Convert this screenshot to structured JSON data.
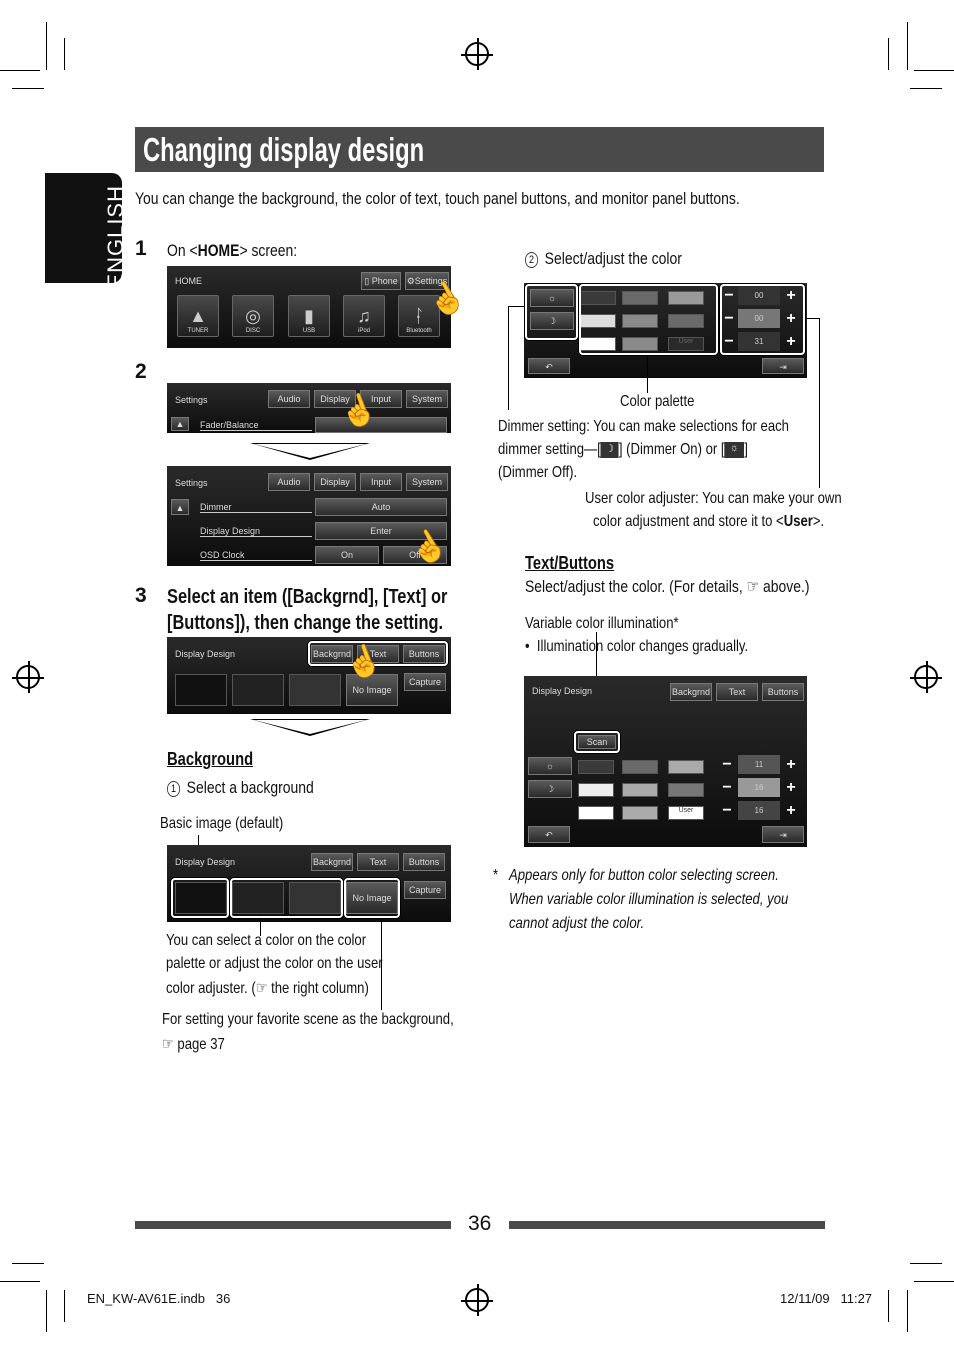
{
  "title": "Changing display design",
  "language_tab": "ENGLISH",
  "intro": "You can change the background, the color of text, touch panel buttons, and monitor panel buttons.",
  "step1": {
    "num": "1",
    "text_pre": "On <",
    "text_bold": "HOME",
    "text_post": "> screen:",
    "screen": {
      "title": "HOME",
      "phone": "Phone",
      "settings": "Settings",
      "icons": [
        "TUNER",
        "DISC",
        "USB",
        "iPod",
        "Bluetooth"
      ]
    }
  },
  "step2": {
    "num": "2",
    "screen_a": {
      "title": "Settings",
      "tabs": [
        "Audio",
        "Display",
        "Input",
        "System"
      ],
      "row": "Fader/Balance"
    },
    "screen_b": {
      "title": "Settings",
      "tabs": [
        "Audio",
        "Display",
        "Input",
        "System"
      ],
      "rows": [
        {
          "label": "Dimmer",
          "value": "Auto"
        },
        {
          "label": "Display Design",
          "value": "Enter"
        },
        {
          "label": "OSD Clock",
          "value": "On",
          "value2": "Off"
        }
      ]
    }
  },
  "step3": {
    "num": "3",
    "line1": "Select an item ([Backgrnd], [Text] or",
    "line2": "[Buttons]), then change the setting.",
    "screen": {
      "title": "Display Design",
      "tabs": [
        "Backgrnd",
        "Text",
        "Buttons"
      ],
      "no_image": "No Image",
      "capture": "Capture"
    }
  },
  "background": {
    "heading": "Background",
    "sub_num": "1",
    "sub_text": "Select a background",
    "basic_label": "Basic image (default)",
    "screen": {
      "title": "Display Design",
      "tabs": [
        "Backgrnd",
        "Text",
        "Buttons"
      ],
      "no_image": "No Image",
      "capture": "Capture"
    },
    "note1": [
      "You can select a color on the color",
      "palette or adjust the color on the user",
      "color adjuster. (☞ the right column)"
    ],
    "note2": [
      "For setting your favorite scene as the background,",
      "☞ page 37"
    ]
  },
  "right": {
    "sub_num": "2",
    "sub_text": "Select/adjust the color",
    "palette_screen": {
      "values": [
        "00",
        "00",
        "31"
      ],
      "user": "User"
    },
    "color_palette_label": "Color palette",
    "dimmer_note": [
      "Dimmer setting: You can make selections for each",
      "dimmer setting—[",
      "] (Dimmer On) or [",
      "]",
      "(Dimmer Off)."
    ],
    "user_note": [
      "User color adjuster: You can make your own",
      "color adjustment and store it to <",
      "User",
      ">."
    ],
    "text_buttons_heading": "Text/Buttons",
    "text_buttons_text": "Select/adjust the color. (For details, ☞ above.)",
    "variable_label": "Variable color illumination*",
    "variable_bullet": "Illumination color changes gradually.",
    "scan_screen": {
      "title": "Display Design",
      "tabs": [
        "Backgrnd",
        "Text",
        "Buttons"
      ],
      "scan": "Scan",
      "values": [
        "11",
        "16",
        "16"
      ],
      "user": "User"
    },
    "footnote_mark": "*",
    "footnote": [
      "Appears only  for button color selecting screen.",
      "When variable color illumination is selected, you",
      "cannot adjust the color."
    ]
  },
  "page_number": "36",
  "footer": {
    "file": "EN_KW-AV61E.indb   36",
    "date": "12/11/09   11:27"
  },
  "colors": {
    "title_bar": "#4a4a4a",
    "tab": "#111111"
  }
}
